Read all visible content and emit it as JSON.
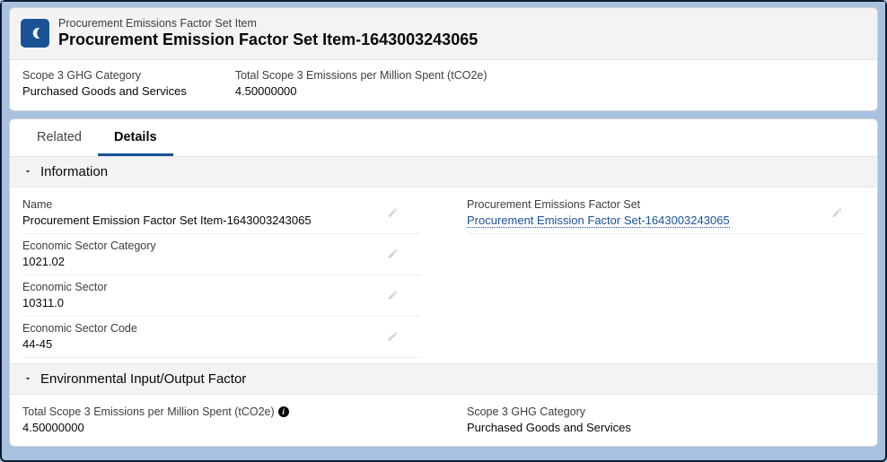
{
  "header": {
    "objectLabel": "Procurement Emissions Factor Set Item",
    "title": "Procurement Emission Factor Set Item-1643003243065"
  },
  "compact": {
    "scope3Category": {
      "label": "Scope 3 GHG Category",
      "value": "Purchased Goods and Services"
    },
    "totalScope3": {
      "label": "Total Scope 3 Emissions per Million Spent (tCO2e)",
      "value": "4.50000000"
    }
  },
  "tabs": {
    "related": "Related",
    "details": "Details"
  },
  "sections": {
    "information": {
      "title": "Information"
    },
    "envio": {
      "title": "Environmental Input/Output Factor"
    }
  },
  "details": {
    "name": {
      "label": "Name",
      "value": "Procurement Emission Factor Set Item-1643003243065"
    },
    "parentSet": {
      "label": "Procurement Emissions Factor Set",
      "value": "Procurement Emission Factor Set-1643003243065"
    },
    "econSectorCategory": {
      "label": "Economic Sector Category",
      "value": "1021.02"
    },
    "econSector": {
      "label": "Economic Sector",
      "value": "10311.0"
    },
    "econSectorCode": {
      "label": "Economic Sector Code",
      "value": "44-45"
    },
    "totalScope3": {
      "label": "Total Scope 3 Emissions per Million Spent (tCO2e)",
      "value": "4.50000000"
    },
    "scope3Category": {
      "label": "Scope 3 GHG Category",
      "value": "Purchased Goods and Services"
    }
  }
}
